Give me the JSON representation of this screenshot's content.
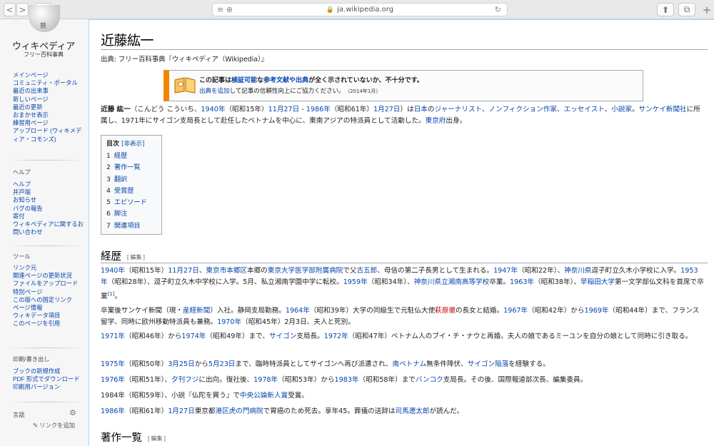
{
  "browser": {
    "url": "ja.wikipedia.org",
    "lock": "🔒",
    "reload": "↻",
    "back": "<",
    "forward": ">",
    "sidebar_toggle": "▢",
    "share": "⬆",
    "tabs": "⧉",
    "new_tab": "+",
    "page_icon": "≡ ⊕"
  },
  "logo": {
    "title": "ウィキペディア",
    "subtitle": "フリー百科事典",
    "glyph": "鉄"
  },
  "sidebar": {
    "main": [
      "メインページ",
      "コミュニティ・ポータル",
      "最近の出来事",
      "新しいページ",
      "最近の更新",
      "おまかせ表示",
      "練習用ページ",
      "アップロード (ウィキメディア・コモンズ)"
    ],
    "help_heading": "ヘルプ",
    "help": [
      "ヘルプ",
      "井戸端",
      "お知らせ",
      "バグの報告",
      "寄付",
      "ウィキペディアに関するお問い合わせ"
    ],
    "tools_heading": "ツール",
    "tools": [
      "リンク元",
      "関連ページの更新状況",
      "ファイルをアップロード",
      "特別ページ",
      "この版への固定リンク",
      "ページ情報",
      "ウィキデータ項目",
      "このページを引用"
    ],
    "print_heading": "印刷/書き出し",
    "print": [
      "ブックの新規作成",
      "PDF 形式でダウンロード",
      "印刷用バージョン"
    ],
    "lang_heading": "言語",
    "gear": "⚙",
    "add_links": "リンクを追加"
  },
  "article": {
    "title": "近藤紘一",
    "source": "出典: フリー百科事典『ウィキペディア（Wikipedia）』",
    "ambox": {
      "line1_pre": "この記事は",
      "line1_a": "検証可能",
      "line1_mid": "な",
      "line1_b": "参考文献や出典",
      "line1_post": "が全く示されていないか、不十分です。",
      "line2_a": "出典を追加",
      "line2_post": "して記事の信頼性向上にご協力ください。",
      "date": "（2014年1月）"
    },
    "lead": [
      {
        "t": "近藤 紘一",
        "b": true
      },
      {
        "t": "（こんどう こういち、"
      },
      {
        "t": "1940年",
        "l": true
      },
      {
        "t": "（昭和15年）"
      },
      {
        "t": "11月27日",
        "l": true
      },
      {
        "t": " - "
      },
      {
        "t": "1986年",
        "l": true
      },
      {
        "t": "（昭和61年）"
      },
      {
        "t": "1月27日",
        "l": true
      },
      {
        "t": "）は"
      },
      {
        "t": "日本",
        "l": true
      },
      {
        "t": "の"
      },
      {
        "t": "ジャーナリスト",
        "l": true
      },
      {
        "t": "、"
      },
      {
        "t": "ノンフィクション作家",
        "l": true
      },
      {
        "t": "、"
      },
      {
        "t": "エッセイスト",
        "l": true
      },
      {
        "t": "、"
      },
      {
        "t": "小説家",
        "l": true
      },
      {
        "t": "。"
      },
      {
        "t": "サンケイ新聞社",
        "l": true
      },
      {
        "t": "に所属し、1971年にサイゴン支局長として赴任したベトナムを中心に、東南アジアの特派員として活動した。"
      },
      {
        "t": "東京府",
        "l": true
      },
      {
        "t": "出身。"
      }
    ],
    "toc": {
      "title": "目次",
      "toggle": "[非表示]",
      "items": [
        {
          "n": "1",
          "label": "経歴"
        },
        {
          "n": "2",
          "label": "著作一覧"
        },
        {
          "n": "3",
          "label": "翻訳"
        },
        {
          "n": "4",
          "label": "受賞歴"
        },
        {
          "n": "5",
          "label": "エピソード"
        },
        {
          "n": "6",
          "label": "脚注"
        },
        {
          "n": "7",
          "label": "関連項目"
        }
      ]
    },
    "section1": {
      "title": "経歴",
      "edit": "[ 編集 ]"
    },
    "paras": [
      [
        {
          "t": "1940年",
          "l": true
        },
        {
          "t": "（昭和15年）"
        },
        {
          "t": "11月27日",
          "l": true
        },
        {
          "t": "、"
        },
        {
          "t": "東京市",
          "l": true
        },
        {
          "t": "本郷区",
          "l": true
        },
        {
          "t": "本郷の"
        },
        {
          "t": "東京大学医学部附属病院",
          "l": true
        },
        {
          "t": "で父"
        },
        {
          "t": "古五郎",
          "l": true
        },
        {
          "t": "、母信の第二子長男として生まれる。"
        },
        {
          "t": "1947年",
          "l": true
        },
        {
          "t": "（昭和22年）、"
        },
        {
          "t": "神奈川県",
          "l": true
        },
        {
          "t": "逗子町立久木小学校に入学。"
        },
        {
          "t": "1953年",
          "l": true
        },
        {
          "t": "（昭和28年）、逗子町立久木中学校に入学。5月、私立湘南学園中学に転校。"
        },
        {
          "t": "1959年",
          "l": true
        },
        {
          "t": "（昭和34年）、"
        },
        {
          "t": "神奈川県立湘南高等学校",
          "l": true
        },
        {
          "t": "卒業。"
        },
        {
          "t": "1963年",
          "l": true
        },
        {
          "t": "（昭和38年）、"
        },
        {
          "t": "早稲田大学",
          "l": true
        },
        {
          "t": "第一文学部仏文科を首席で卒業"
        },
        {
          "t": "[1]",
          "l": true,
          "sup": true
        },
        {
          "t": "。"
        }
      ],
      [
        {
          "t": "卒業後サンケイ新聞（現・"
        },
        {
          "t": "産経新聞",
          "l": true
        },
        {
          "t": "）入社。静岡支局勤務。"
        },
        {
          "t": "1964年",
          "l": true
        },
        {
          "t": "（昭和39年）大学の同級生で元駐仏大使"
        },
        {
          "t": "萩原徹",
          "r": true
        },
        {
          "t": "の長女と結婚。"
        },
        {
          "t": "1967年",
          "l": true
        },
        {
          "t": "（昭和42年）から"
        },
        {
          "t": "1969年",
          "l": true
        },
        {
          "t": "（昭和44年）まで、フランス留学、同時に欧州移動特派員も兼務。"
        },
        {
          "t": "1970年",
          "l": true
        },
        {
          "t": "（昭和45年）2月3日、夫人と死別。"
        }
      ],
      [
        {
          "t": "1971年",
          "l": true
        },
        {
          "t": "（昭和46年）から"
        },
        {
          "t": "1974年",
          "l": true
        },
        {
          "t": "（昭和49年）まで、"
        },
        {
          "t": "サイゴン",
          "l": true
        },
        {
          "t": "支局長。"
        },
        {
          "t": "1972年",
          "l": true
        },
        {
          "t": "（昭和47年）ベトナム人のブイ・チ・ナウと再婚。夫人の娘であるミーユンを自分の娘として同時に引き取る。"
        }
      ],
      [
        {
          "t": "1975年",
          "l": true
        },
        {
          "t": "（昭和50年）"
        },
        {
          "t": "3月25日",
          "l": true
        },
        {
          "t": "から"
        },
        {
          "t": "5月23日",
          "l": true
        },
        {
          "t": "まで、臨時特派員としてサイゴンへ再び派遣され、"
        },
        {
          "t": "南ベトナム",
          "l": true
        },
        {
          "t": "無条件降伏、"
        },
        {
          "t": "サイゴン陥落",
          "l": true
        },
        {
          "t": "を経験する。"
        }
      ],
      [
        {
          "t": "1976年",
          "l": true
        },
        {
          "t": "（昭和51年）、"
        },
        {
          "t": "夕刊フジ",
          "l": true
        },
        {
          "t": "に出向。復社後、"
        },
        {
          "t": "1978年",
          "l": true
        },
        {
          "t": "（昭和53年）から"
        },
        {
          "t": "1983年",
          "l": true
        },
        {
          "t": "（昭和58年）まで"
        },
        {
          "t": "バンコク",
          "l": true
        },
        {
          "t": "支局長。その後、国際報道部次長、編集委員。"
        }
      ],
      [
        {
          "t": "1984年（昭和59年）、小説『仏陀を買う』で"
        },
        {
          "t": "中央公論新人賞",
          "l": true
        },
        {
          "t": "受賞。"
        }
      ],
      [
        {
          "t": "1986年",
          "l": true
        },
        {
          "t": "（昭和61年）"
        },
        {
          "t": "1月27日",
          "l": true
        },
        {
          "t": "東京都"
        },
        {
          "t": "港区",
          "l": true
        },
        {
          "t": "虎の門病院",
          "l": true
        },
        {
          "t": "で胃癌のため死去。享年45。葬儀の送辞は"
        },
        {
          "t": "司馬遼太郎",
          "l": true
        },
        {
          "t": "が読んだ。"
        }
      ]
    ],
    "section2": {
      "title": "著作一覧",
      "edit": "[ 編集 ]"
    }
  }
}
